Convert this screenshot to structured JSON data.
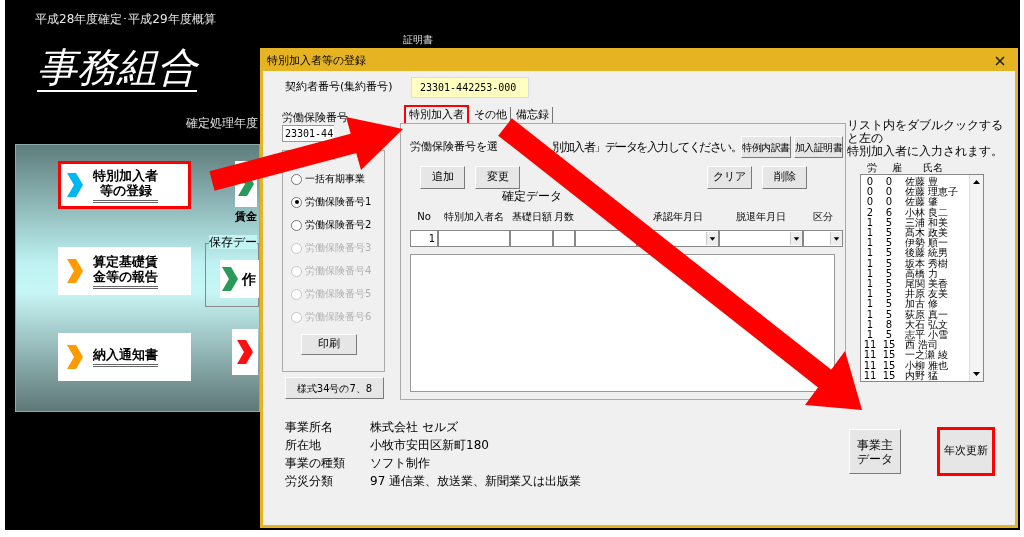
{
  "background": {
    "title": "平成28年度確定･平成29年度概算",
    "app_name": "事務組合",
    "top_caption": "証明書",
    "year_label": "確定処理年度",
    "menu_buttons": [
      {
        "lines": [
          "特別加入者",
          "等の登録"
        ],
        "color": "#00b7f0",
        "selected": true
      },
      {
        "lines": [
          "算定基礎賃",
          "金等の報告"
        ],
        "color": "#ff9a00",
        "selected": false
      },
      {
        "lines": [
          "納入通知書"
        ],
        "color": "#ff9a00",
        "selected": false
      }
    ],
    "partial_buttons": [
      {
        "color": "#2a9a5a"
      },
      {
        "color": "#ff1010"
      }
    ],
    "caption": "賃金",
    "group_label": "保存デー",
    "group_button": {
      "label": "作",
      "color": "#2a9a5a"
    }
  },
  "dialog": {
    "title": "特別加入者等の登録",
    "contract_label": "契約者番号(集約番号)",
    "contract_value": "23301-442253-000",
    "insurance_label": "労働保険番号",
    "insurance_value": "23301-44",
    "radios": [
      {
        "label": "一括有期事業",
        "selected": false,
        "disabled": false
      },
      {
        "label": "労働保険番号1",
        "selected": true,
        "disabled": false
      },
      {
        "label": "労働保険番号2",
        "selected": false,
        "disabled": false
      },
      {
        "label": "労働保険番号3",
        "selected": false,
        "disabled": true
      },
      {
        "label": "労働保険番号4",
        "selected": false,
        "disabled": true
      },
      {
        "label": "労働保険番号5",
        "selected": false,
        "disabled": true
      },
      {
        "label": "労働保険番号6",
        "selected": false,
        "disabled": true
      }
    ],
    "print_button": "印刷",
    "form_button": "様式34号の7、8",
    "tabs": [
      {
        "label": "特別加入者",
        "selected": true
      },
      {
        "label": "その他",
        "selected": false
      },
      {
        "label": "備忘録",
        "selected": false
      }
    ],
    "instruction_parts": [
      "労働保険番号を選",
      "別加入者」データを入力してください。"
    ],
    "top_buttons": [
      "特例内訳書",
      "加入証明書"
    ],
    "left_buttons": [
      "追加",
      "変更"
    ],
    "right_buttons": [
      "クリア",
      "削除"
    ],
    "group_header": "確定データ",
    "columns": [
      "No",
      "特別加入者名",
      "基礎日額",
      "月数",
      "",
      "承認年月日",
      "脱退年月日",
      "区分"
    ],
    "no_value": "1",
    "list_note": [
      "リスト内をダブルクックすると左の",
      "特別加入者に入力されます。"
    ],
    "list_columns": [
      "労",
      "雇",
      "氏名"
    ],
    "list_rows": [
      [
        "0",
        "0",
        "佐藤 豊"
      ],
      [
        "0",
        "0",
        "佐藤 理恵子"
      ],
      [
        "0",
        "0",
        "佐藤 肇"
      ],
      [
        "2",
        "6",
        "小林 良二"
      ],
      [
        "1",
        "5",
        "三浦 和美"
      ],
      [
        "1",
        "5",
        "髙木 政美"
      ],
      [
        "1",
        "5",
        "伊勢 順一"
      ],
      [
        "1",
        "5",
        "後藤 統男"
      ],
      [
        "1",
        "5",
        "坂本 秀樹"
      ],
      [
        "1",
        "5",
        "高橋 力"
      ],
      [
        "1",
        "5",
        "尾関 美香"
      ],
      [
        "1",
        "5",
        "井原 友美"
      ],
      [
        "1",
        "5",
        "加古 修"
      ],
      [
        "1",
        "5",
        "荻原 真一"
      ],
      [
        "1",
        "8",
        "大石 弘文"
      ],
      [
        "1",
        "5",
        "志平 小雪"
      ],
      [
        "11",
        "15",
        "西 浩司"
      ],
      [
        "11",
        "15",
        "一之瀬 綾"
      ],
      [
        "11",
        "15",
        "小柳 雅也"
      ],
      [
        "11",
        "15",
        "内野 猛"
      ]
    ],
    "info": [
      [
        "事業所名",
        "株式会社 セルズ"
      ],
      [
        "所在地",
        "小牧市安田区新町180"
      ],
      [
        "事業の種類",
        "ソフト制作"
      ],
      [
        "労災分類",
        "97 通信業、放送業、新聞業又は出版業"
      ]
    ],
    "owner_button": [
      "事業主",
      "データ"
    ],
    "update_button": {
      "label": "年次更新",
      "highlighted": true
    }
  }
}
